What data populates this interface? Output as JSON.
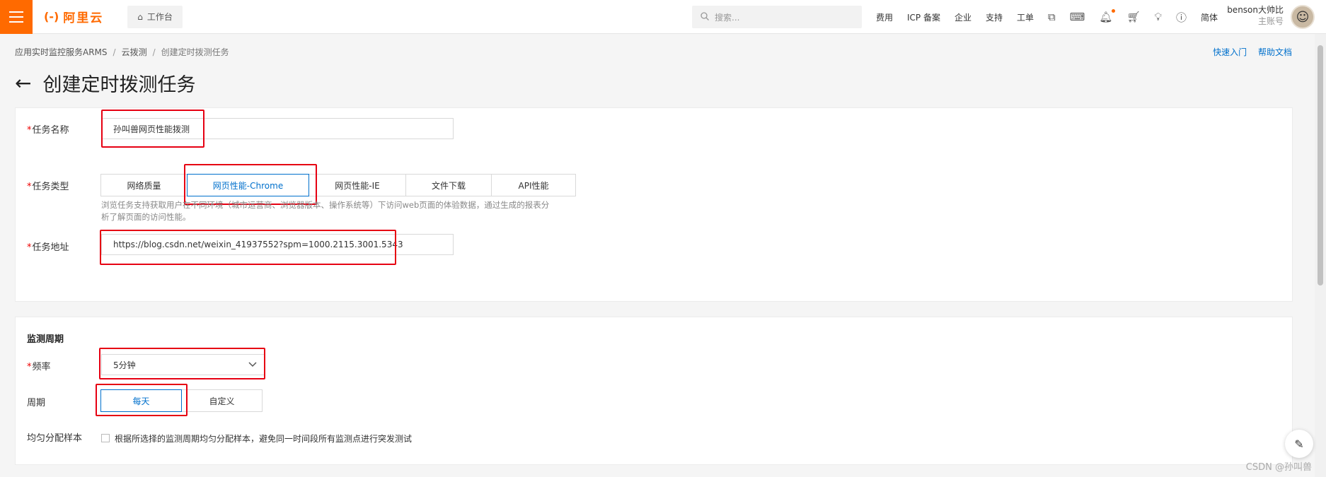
{
  "topbar": {
    "logo_mark": "(-)",
    "logo_text": "阿里云",
    "workbench": "工作台",
    "search_placeholder": "搜索...",
    "nav_items": [
      "费用",
      "ICP 备案",
      "企业",
      "支持",
      "工单"
    ],
    "lang": "简体",
    "user_name": "benson大帅比",
    "user_sub": "主账号"
  },
  "breadcrumb": [
    "应用实时监控服务ARMS",
    "云拨测",
    "创建定时拨测任务"
  ],
  "quick_links": [
    "快速入门",
    "帮助文档"
  ],
  "page_title": "创建定时拨测任务",
  "form": {
    "task_name_label": "任务名称",
    "task_name_value": "孙叫兽网页性能拨测",
    "task_type_label": "任务类型",
    "task_type_options": [
      "网络质量",
      "网页性能-Chrome",
      "网页性能-IE",
      "文件下载",
      "API性能"
    ],
    "task_type_selected": "网页性能-Chrome",
    "task_type_hint_line1": "浏览任务支持获取用户在不同环境（城市运营商、浏览器版本、操作系统等）下访问web页面的体验数据，通过生成的报表分",
    "task_type_hint_line2": "析了解页面的访问性能。",
    "task_url_label": "任务地址",
    "task_url_value": "https://blog.csdn.net/weixin_41937552?spm=1000.2115.3001.5343"
  },
  "monitor": {
    "section_title": "监测周期",
    "frequency_label": "频率",
    "frequency_value": "5分钟",
    "period_label": "周期",
    "period_options": [
      "每天",
      "自定义"
    ],
    "period_selected": "每天",
    "distribute_label": "均匀分配样本",
    "distribute_text": "根据所选择的监测周期均匀分配样本，避免同一时间段所有监测点进行突发测试"
  },
  "watermark": "CSDN @孙叫兽",
  "colors": {
    "accent": "#ff6a00",
    "link": "#0070cc",
    "highlight": "#e60012"
  }
}
